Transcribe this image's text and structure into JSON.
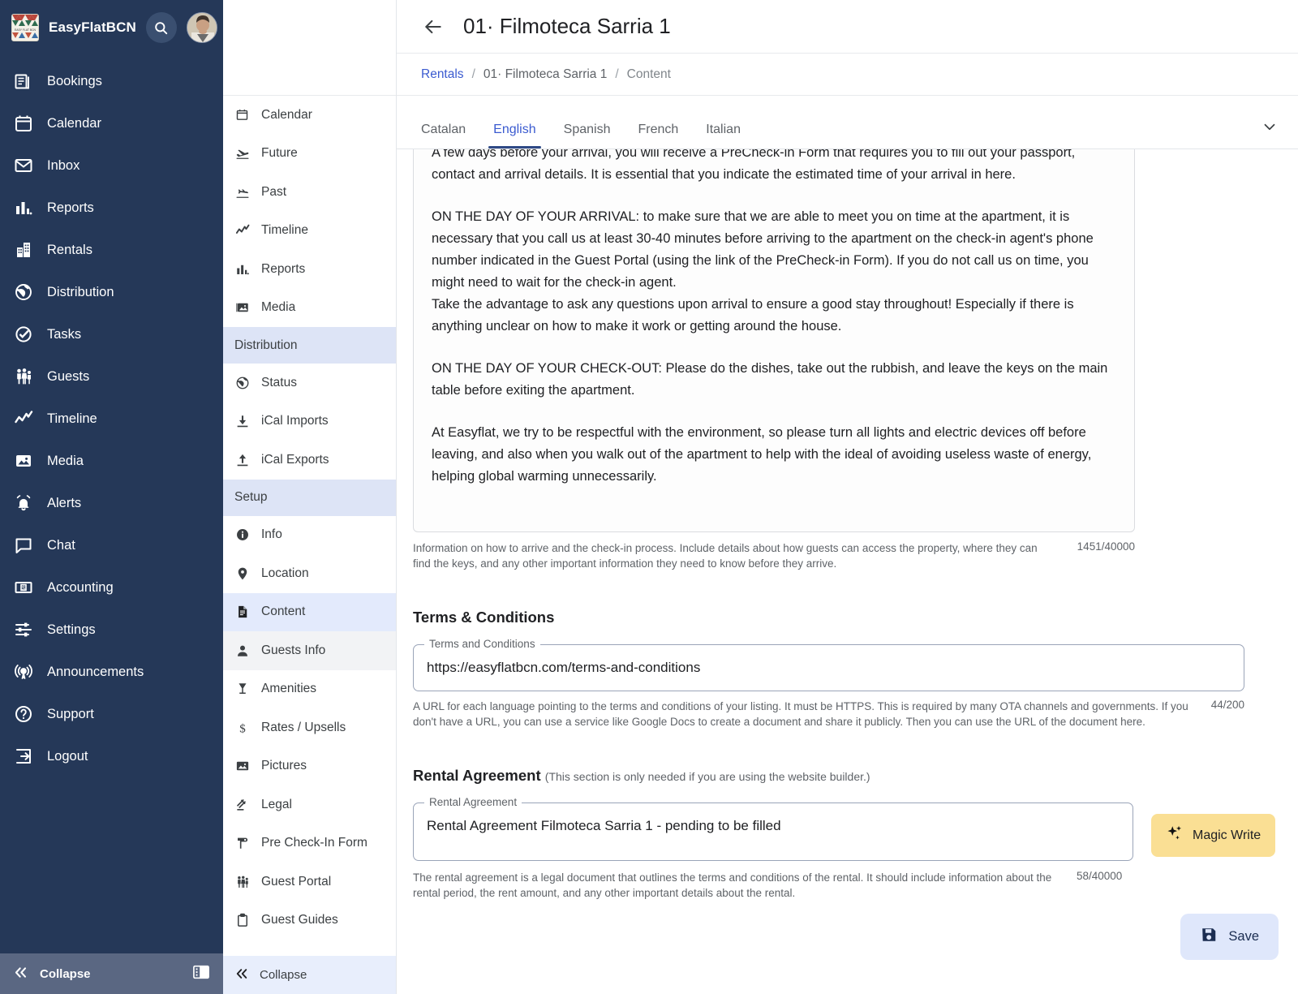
{
  "brand": {
    "name": "EasyFlatBCN",
    "search_icon": "search-icon",
    "avatar": "user-avatar"
  },
  "sidebar": {
    "items": [
      {
        "label": "Bookings",
        "icon": "bookings-icon"
      },
      {
        "label": "Calendar",
        "icon": "calendar-icon"
      },
      {
        "label": "Inbox",
        "icon": "inbox-icon"
      },
      {
        "label": "Reports",
        "icon": "reports-icon"
      },
      {
        "label": "Rentals",
        "icon": "rentals-icon"
      },
      {
        "label": "Distribution",
        "icon": "distribution-icon"
      },
      {
        "label": "Tasks",
        "icon": "tasks-icon"
      },
      {
        "label": "Guests",
        "icon": "guests-icon"
      },
      {
        "label": "Timeline",
        "icon": "timeline-icon"
      },
      {
        "label": "Media",
        "icon": "media-icon"
      },
      {
        "label": "Alerts",
        "icon": "alerts-icon"
      },
      {
        "label": "Chat",
        "icon": "chat-icon"
      },
      {
        "label": "Accounting",
        "icon": "accounting-icon"
      },
      {
        "label": "Settings",
        "icon": "settings-icon"
      },
      {
        "label": "Announcements",
        "icon": "announcements-icon"
      },
      {
        "label": "Support",
        "icon": "support-icon"
      },
      {
        "label": "Logout",
        "icon": "logout-icon"
      }
    ],
    "collapse_label": "Collapse"
  },
  "subnav": {
    "items": [
      {
        "label": "Calendar",
        "type": "item",
        "icon": "calendar-icon",
        "state": ""
      },
      {
        "label": "Future",
        "type": "item",
        "icon": "plane-arrival-icon",
        "state": ""
      },
      {
        "label": "Past",
        "type": "item",
        "icon": "plane-departure-icon",
        "state": ""
      },
      {
        "label": "Timeline",
        "type": "item",
        "icon": "timeline-icon",
        "state": ""
      },
      {
        "label": "Reports",
        "type": "item",
        "icon": "reports-icon",
        "state": ""
      },
      {
        "label": "Media",
        "type": "item",
        "icon": "media-icon",
        "state": ""
      },
      {
        "label": "Distribution",
        "type": "header",
        "icon": "",
        "state": ""
      },
      {
        "label": "Status",
        "type": "item",
        "icon": "globe-icon",
        "state": ""
      },
      {
        "label": "iCal Imports",
        "type": "item",
        "icon": "download-icon",
        "state": ""
      },
      {
        "label": "iCal Exports",
        "type": "item",
        "icon": "upload-icon",
        "state": ""
      },
      {
        "label": "Setup",
        "type": "header",
        "icon": "",
        "state": ""
      },
      {
        "label": "Info",
        "type": "item",
        "icon": "info-icon",
        "state": ""
      },
      {
        "label": "Location",
        "type": "item",
        "icon": "pin-icon",
        "state": ""
      },
      {
        "label": "Content",
        "type": "item",
        "icon": "document-icon",
        "state": "active"
      },
      {
        "label": "Guests Info",
        "type": "item",
        "icon": "person-icon",
        "state": "hovered"
      },
      {
        "label": "Amenities",
        "type": "item",
        "icon": "glass-icon",
        "state": ""
      },
      {
        "label": "Rates / Upsells",
        "type": "item",
        "icon": "dollar-icon",
        "state": ""
      },
      {
        "label": "Pictures",
        "type": "item",
        "icon": "picture-icon",
        "state": ""
      },
      {
        "label": "Legal",
        "type": "item",
        "icon": "gavel-icon",
        "state": ""
      },
      {
        "label": "Pre Check-In Form",
        "type": "item",
        "icon": "stamp-icon",
        "state": ""
      },
      {
        "label": "Guest Portal",
        "type": "item",
        "icon": "guests-icon",
        "state": ""
      },
      {
        "label": "Guest Guides",
        "type": "item",
        "icon": "clipboard-icon",
        "state": ""
      }
    ],
    "collapse_label": "Collapse"
  },
  "header": {
    "back_icon": "back-arrow-icon",
    "title": "01· Filmoteca Sarria 1"
  },
  "breadcrumb": {
    "root": "Rentals",
    "sep": "/",
    "middle": "01· Filmoteca Sarria 1",
    "current": "Content"
  },
  "language_tabs": {
    "items": [
      "Catalan",
      "English",
      "Spanish",
      "French",
      "Italian"
    ],
    "active": "English",
    "expand_icon": "chevron-down-icon"
  },
  "arrival_field": {
    "paragraphs": [
      "A few days before your arrival, you will receive a PreCheck-in Form that requires you to fill out your passport, contact and arrival details. It is essential that you indicate the estimated time of your arrival in here.",
      "ON THE DAY OF YOUR ARRIVAL: to make sure that we are able to meet you on time at the apartment, it is necessary that you call us at least 30-40 minutes before arriving to the apartment on the check-in agent's phone number indicated in the Guest Portal (using the link of the PreCheck-in Form). If you do not call us on time, you might need to wait for the check-in agent.\nTake the advantage to ask any questions upon arrival to ensure a good stay throughout! Especially if there is anything unclear on how to make it work or getting around the house.",
      "ON THE DAY OF YOUR CHECK-OUT: Please do the dishes, take out the rubbish, and leave the keys on the main table before exiting the apartment.",
      "At Easyflat, we try to be respectful with the environment, so please turn all lights and electric devices off before leaving, and also when you walk out of the apartment to help with the ideal of avoiding useless waste of energy, helping global warming unnecessarily."
    ],
    "helper": "Information on how to arrive and the check-in process. Include details about how guests can access the property, where they can find the keys, and any other important information they need to know before they arrive.",
    "counter": "1451/40000"
  },
  "terms_section": {
    "title": "Terms & Conditions",
    "legend": "Terms and Conditions",
    "value": "https://easyflatbcn.com/terms-and-conditions",
    "helper": "A URL for each language pointing to the terms and conditions of your listing. It must be HTTPS. This is required by many OTA channels and governments. If you don't have a URL, you can use a service like Google Docs to create a document and share it publicly. Then you can use the URL of the document here.",
    "counter": "44/200"
  },
  "rental_agreement": {
    "title": "Rental Agreement",
    "title_note": "(This section is only needed if you are using the website builder.)",
    "legend": "Rental Agreement",
    "value": "Rental Agreement Filmoteca Sarria 1 - pending to be filled",
    "helper": "The rental agreement is a legal document that outlines the terms and conditions of the rental. It should include information about the rental period, the rent amount, and any other important details about the rental.",
    "counter": "58/40000",
    "magic_write_label": "Magic Write",
    "magic_write_icon": "sparkle-icon"
  },
  "footer": {
    "save_label": "Save",
    "save_icon": "save-disk-icon"
  },
  "colors": {
    "sidebar_bg": "#253858",
    "sidebar_collapse_bg": "#5a6782",
    "accent_link": "#3b5bd0",
    "subnav_header_bg": "#dde4f6",
    "subnav_active_bg": "#e3eafc",
    "magic_write_bg": "#fadf94",
    "save_bg": "#dfe7fb",
    "tab_active_underline": "#2f4a86"
  }
}
